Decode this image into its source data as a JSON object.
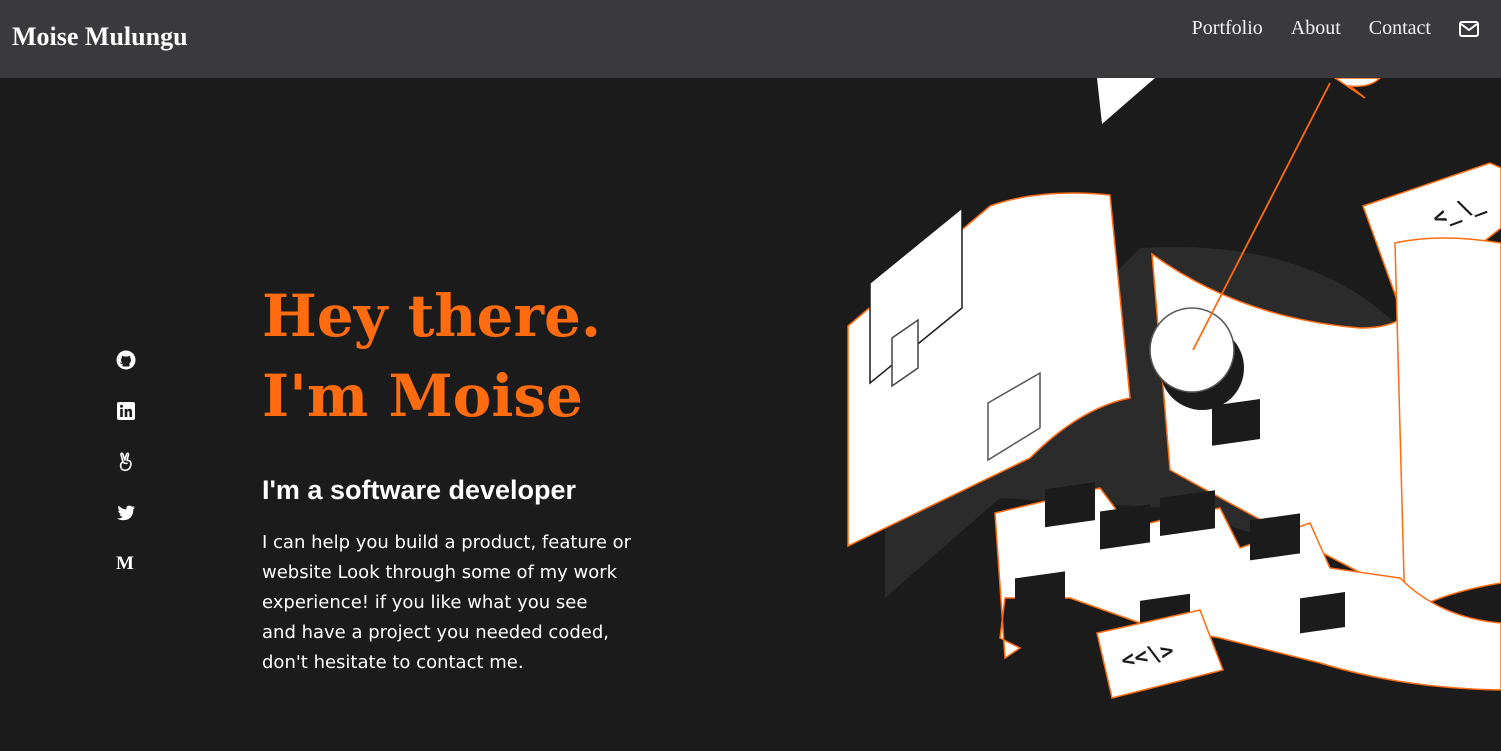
{
  "brand": {
    "name": "Moise Mulungu"
  },
  "nav": {
    "links": [
      {
        "label": "Portfolio"
      },
      {
        "label": "About"
      },
      {
        "label": "Contact"
      }
    ],
    "mail_icon": "envelope-icon"
  },
  "social": {
    "icons": [
      "github-icon",
      "linkedin-icon",
      "angellist-icon",
      "twitter-icon",
      "medium-icon"
    ],
    "medium_glyph": "M"
  },
  "hero": {
    "line1": "Hey there.",
    "line2": "I'm Moise",
    "subtitle": "I'm a software developer",
    "text_lines": [
      "I can help you build a product, feature or",
      "website Look through some of my work",
      "experience! if you like what you see",
      "and have a project you needed coded,",
      "don't hesitate to contact me."
    ]
  },
  "illustration": {
    "code_tag_top": "<_\\_",
    "code_tag_bottom": "<<\\>"
  },
  "colors": {
    "accent": "#ff6b0f",
    "navbar": "#3a393c",
    "background": "#1c1b1b",
    "text": "#ffffff"
  }
}
